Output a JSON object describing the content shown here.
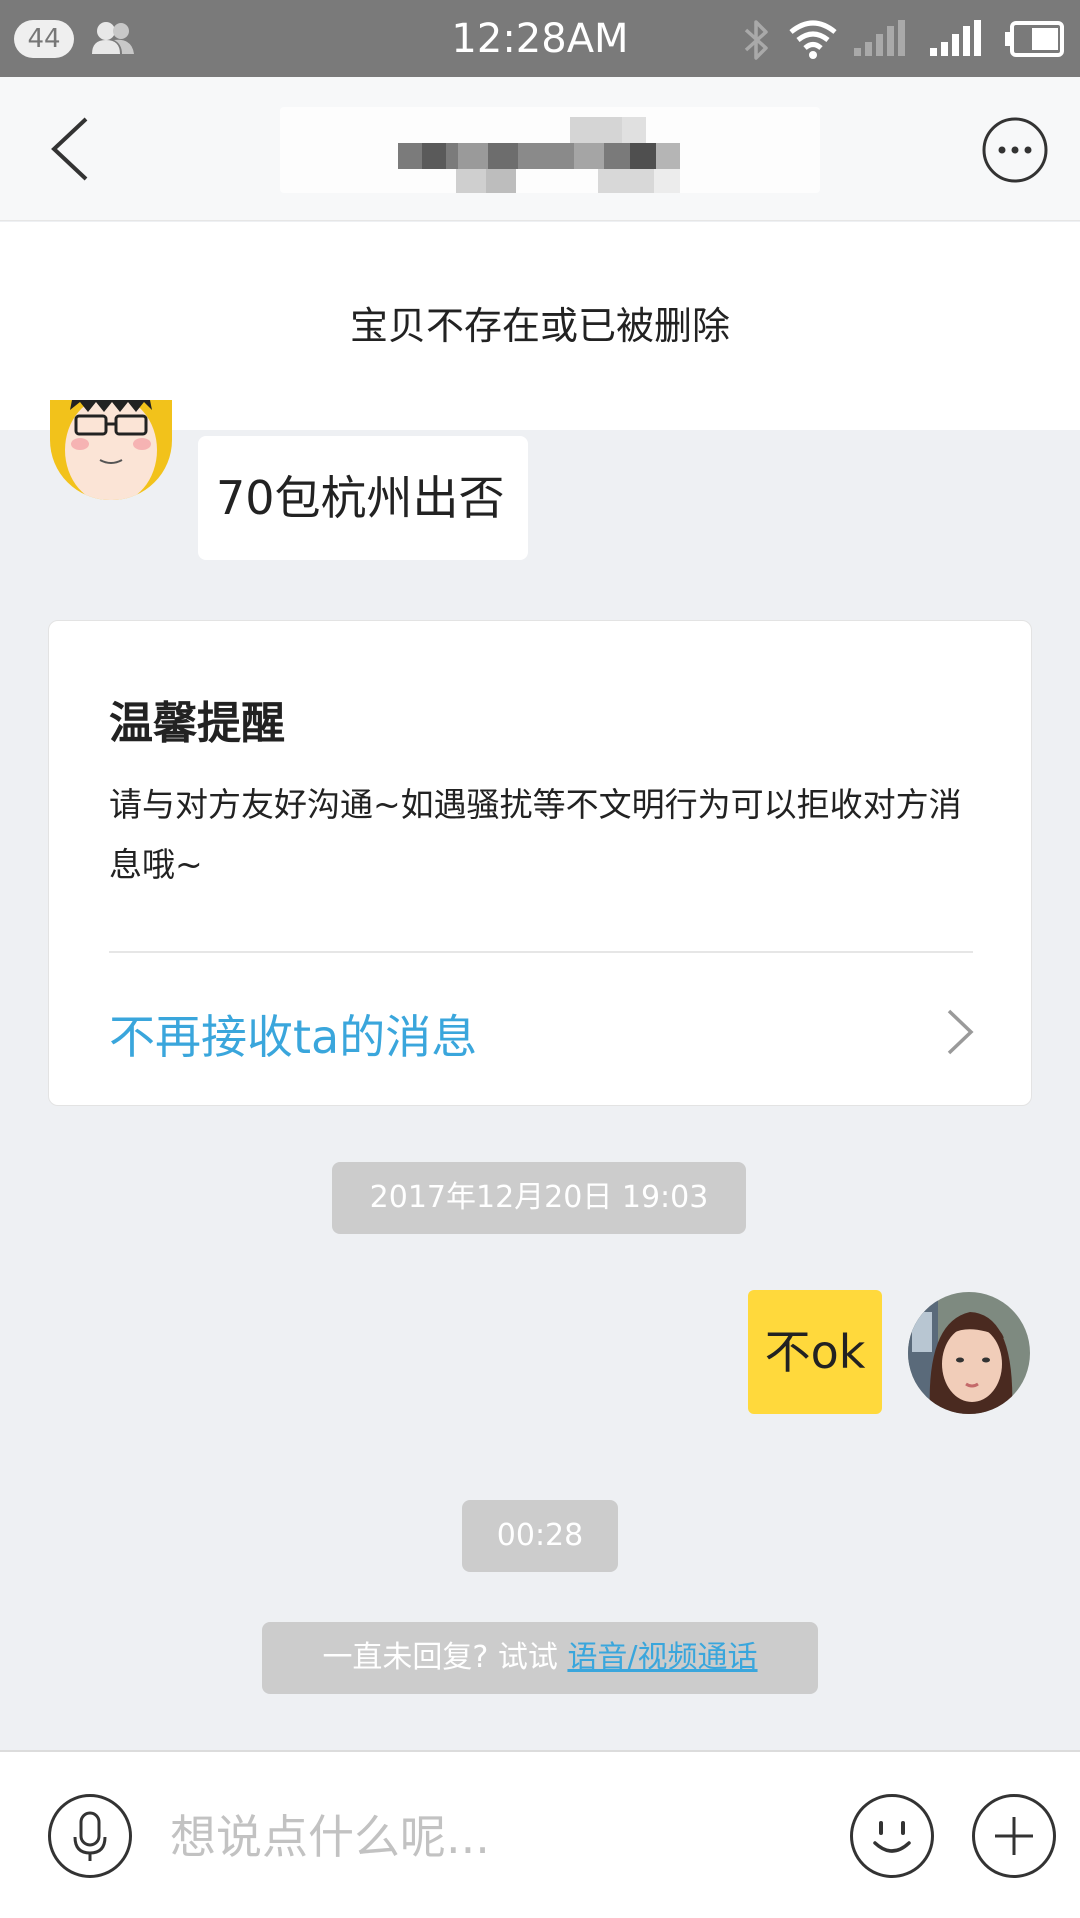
{
  "status_bar": {
    "notification_count": "44",
    "time": "12:28AM",
    "icons": [
      "contacts-icon",
      "bluetooth-icon",
      "wifi-icon",
      "signal-icon",
      "signal-icon",
      "battery-icon"
    ]
  },
  "nav": {
    "back_icon": "chevron-left-icon",
    "title": "",
    "more_icon": "more-icon"
  },
  "banner": {
    "text": "宝贝不存在或已被删除"
  },
  "messages": [
    {
      "from": "other",
      "text": "70包杭州出否"
    },
    {
      "from": "me",
      "text": "不ok"
    }
  ],
  "reminder": {
    "title": "温馨提醒",
    "body": "请与对方友好沟通~如遇骚扰等不文明行为可以拒收对方消息哦~",
    "action": "不再接收ta的消息"
  },
  "timestamps": {
    "first": "2017年12月20日 19:03",
    "second": "00:28"
  },
  "hint": {
    "prefix": "一直未回复? 试试 ",
    "link": "语音/视频通话"
  },
  "input_bar": {
    "placeholder": "想说点什么呢...",
    "value": "",
    "icons": [
      "microphone-icon",
      "emoji-icon",
      "plus-icon"
    ]
  },
  "colors": {
    "status_bar": "#7a7a7a",
    "background": "#eef0f3",
    "link": "#3aa6dc",
    "my_bubble": "#ffd93c",
    "pill": "#cccccc"
  }
}
